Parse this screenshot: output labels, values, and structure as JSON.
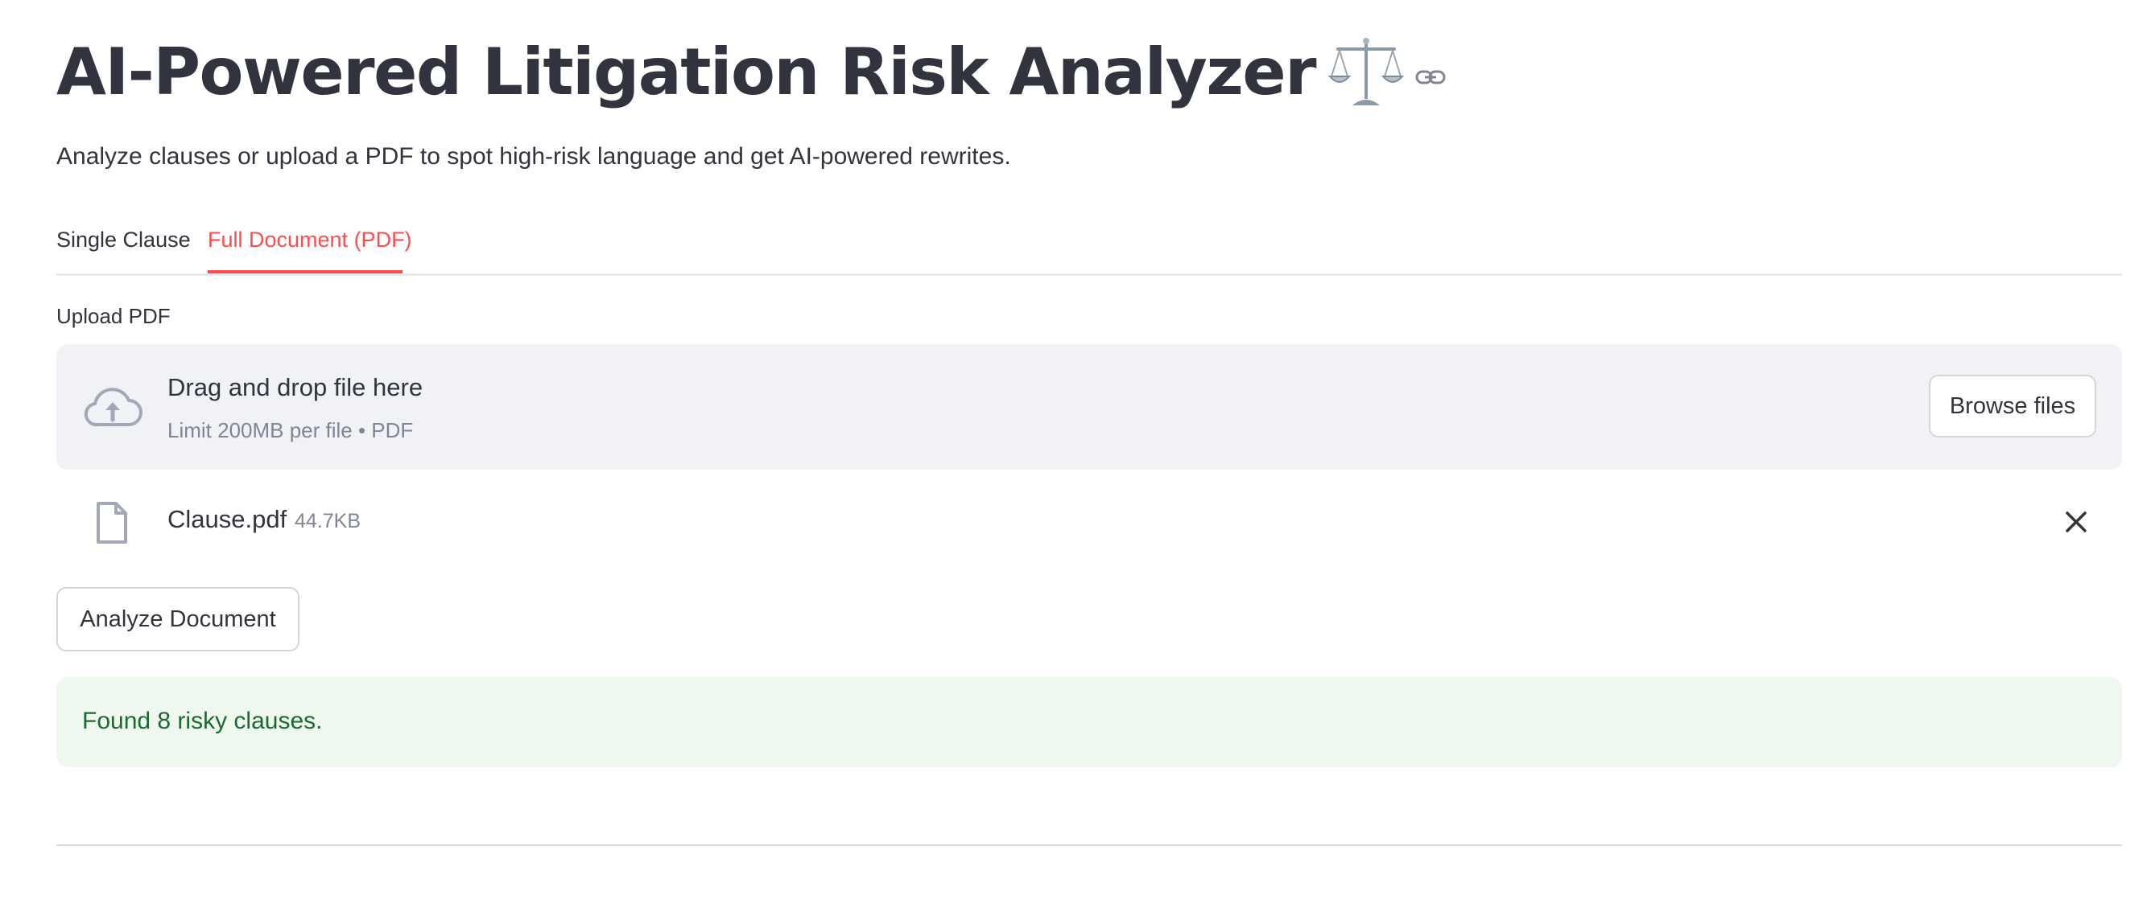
{
  "header": {
    "title": "AI-Powered Litigation Risk Analyzer",
    "title_icon": "balance-scale-icon",
    "anchor_icon": "link-icon",
    "subtitle": "Analyze clauses or upload a PDF to spot high-risk language and get AI-powered rewrites."
  },
  "tabs": [
    {
      "label": "Single Clause",
      "active": false
    },
    {
      "label": "Full Document (PDF)",
      "active": true
    }
  ],
  "upload": {
    "label": "Upload PDF",
    "drop_title": "Drag and drop file here",
    "drop_limit": "Limit 200MB per file • PDF",
    "browse_label": "Browse files",
    "icon": "cloud-upload-icon"
  },
  "file": {
    "name": "Clause.pdf",
    "size": "44.7KB",
    "icon": "file-icon",
    "remove_icon": "close-icon"
  },
  "actions": {
    "analyze_label": "Analyze Document"
  },
  "status": {
    "message": "Found 8 risky clauses."
  },
  "colors": {
    "accent": "#ff4b4b",
    "text": "#31333f",
    "muted": "#808495",
    "dropzone_bg": "#f0f2f6",
    "success_bg": "#eef8ef",
    "success_text": "#1d6a31"
  }
}
